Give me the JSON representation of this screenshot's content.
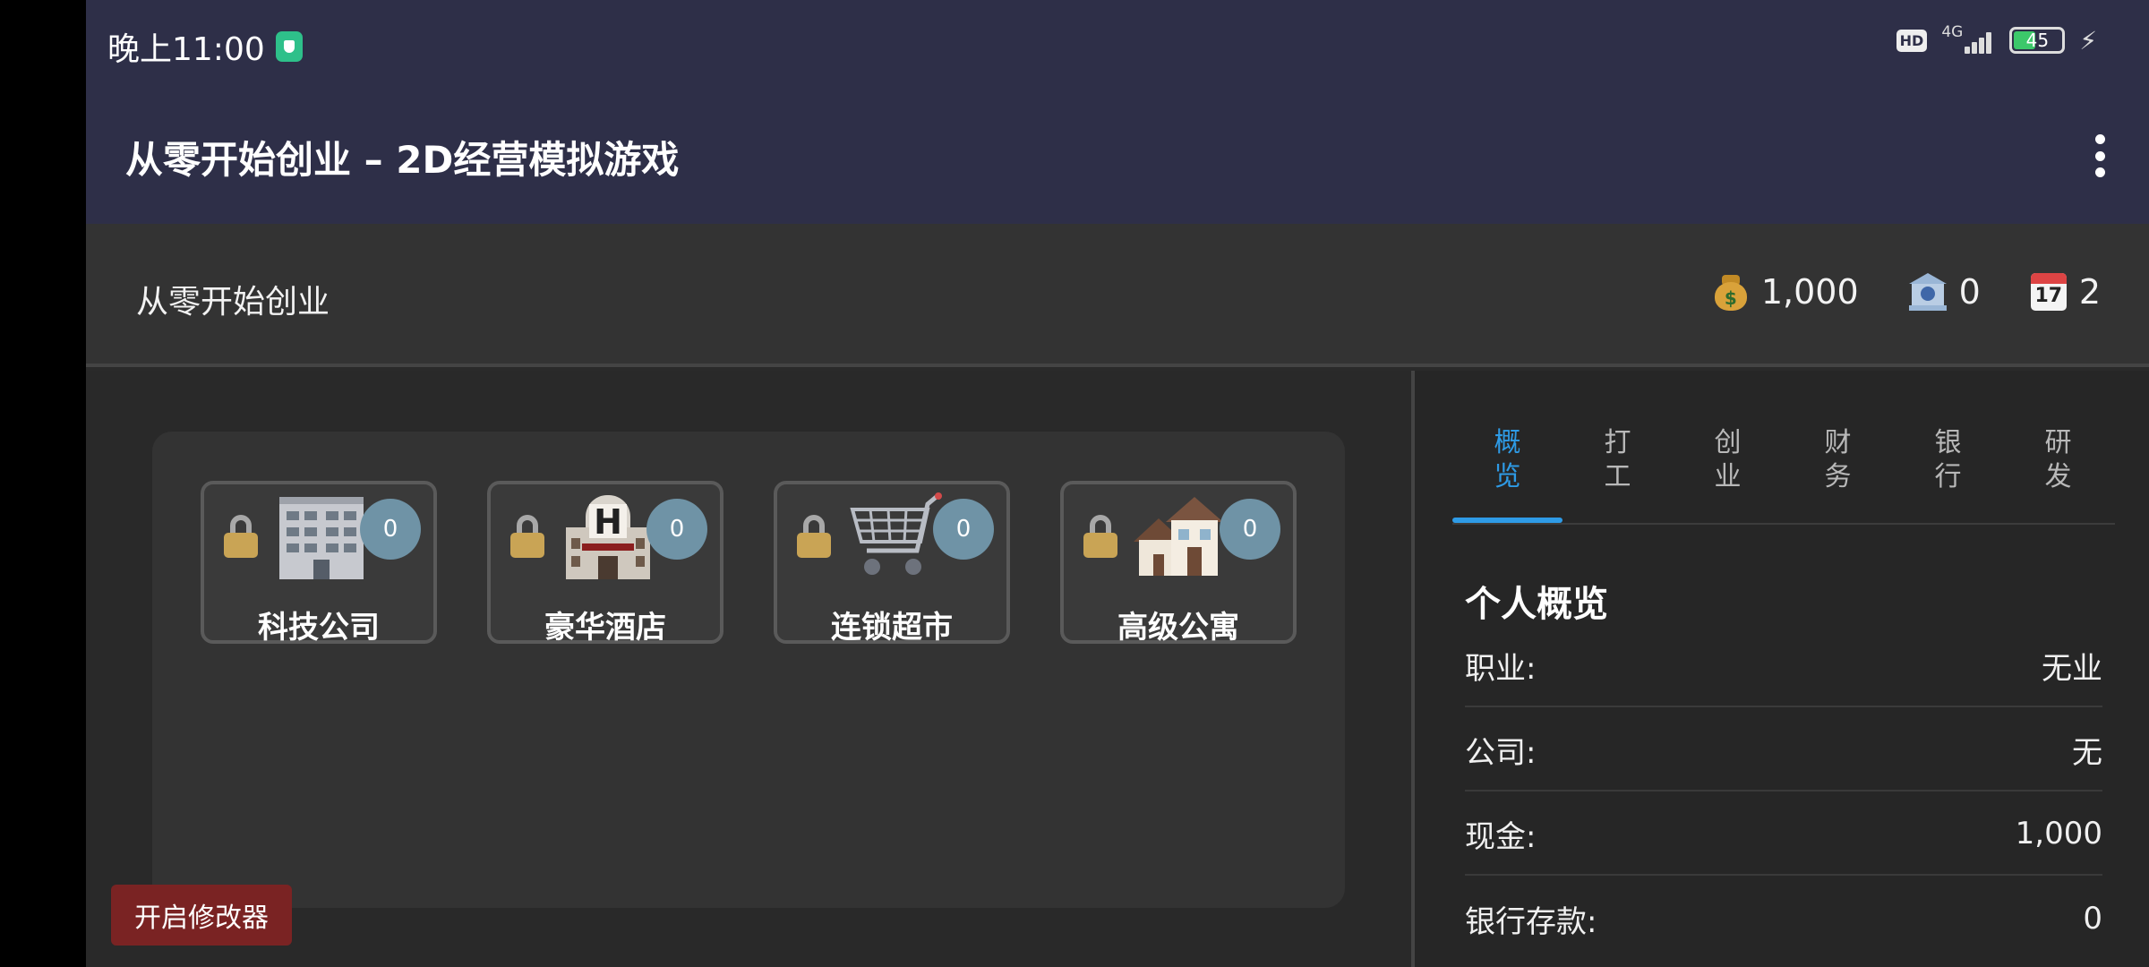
{
  "status_bar": {
    "time": "晚上11:00",
    "hd_label": "HD",
    "network": "4G",
    "battery": "45",
    "battery_level": 0.45
  },
  "app_bar": {
    "title": "从零开始创业 – 2D经营模拟游戏",
    "menu_icon": "more-vert-icon"
  },
  "header": {
    "title": "从零开始创业",
    "stats": [
      {
        "icon": "money-bag-icon",
        "value": "1,000"
      },
      {
        "icon": "bank-icon",
        "value": "0"
      },
      {
        "icon": "calendar-icon",
        "value": "2",
        "icon_text": "17"
      }
    ]
  },
  "businesses": [
    {
      "name": "科技公司",
      "count": "0",
      "icon": "office-building-icon",
      "locked": true
    },
    {
      "name": "豪华酒店",
      "count": "0",
      "icon": "hotel-icon",
      "locked": true
    },
    {
      "name": "连锁超市",
      "count": "0",
      "icon": "shopping-cart-icon",
      "locked": true
    },
    {
      "name": "高级公寓",
      "count": "0",
      "icon": "houses-icon",
      "locked": true
    }
  ],
  "modifier_button": "开启修改器",
  "side_panel": {
    "tabs": [
      {
        "label": "概览",
        "active": true
      },
      {
        "label": "打工",
        "active": false
      },
      {
        "label": "创业",
        "active": false
      },
      {
        "label": "财务",
        "active": false
      },
      {
        "label": "银行",
        "active": false
      },
      {
        "label": "研发",
        "active": false
      }
    ],
    "section_title": "个人概览",
    "rows": [
      {
        "label": "职业:",
        "value": "无业"
      },
      {
        "label": "公司:",
        "value": "无"
      },
      {
        "label": "现金:",
        "value": "1,000"
      },
      {
        "label": "银行存款:",
        "value": "0"
      }
    ]
  },
  "colors": {
    "app_bar": "#2e2f48",
    "accent": "#2e9be6",
    "badge": "#6f93a6",
    "modifier_button": "#7a2323"
  }
}
